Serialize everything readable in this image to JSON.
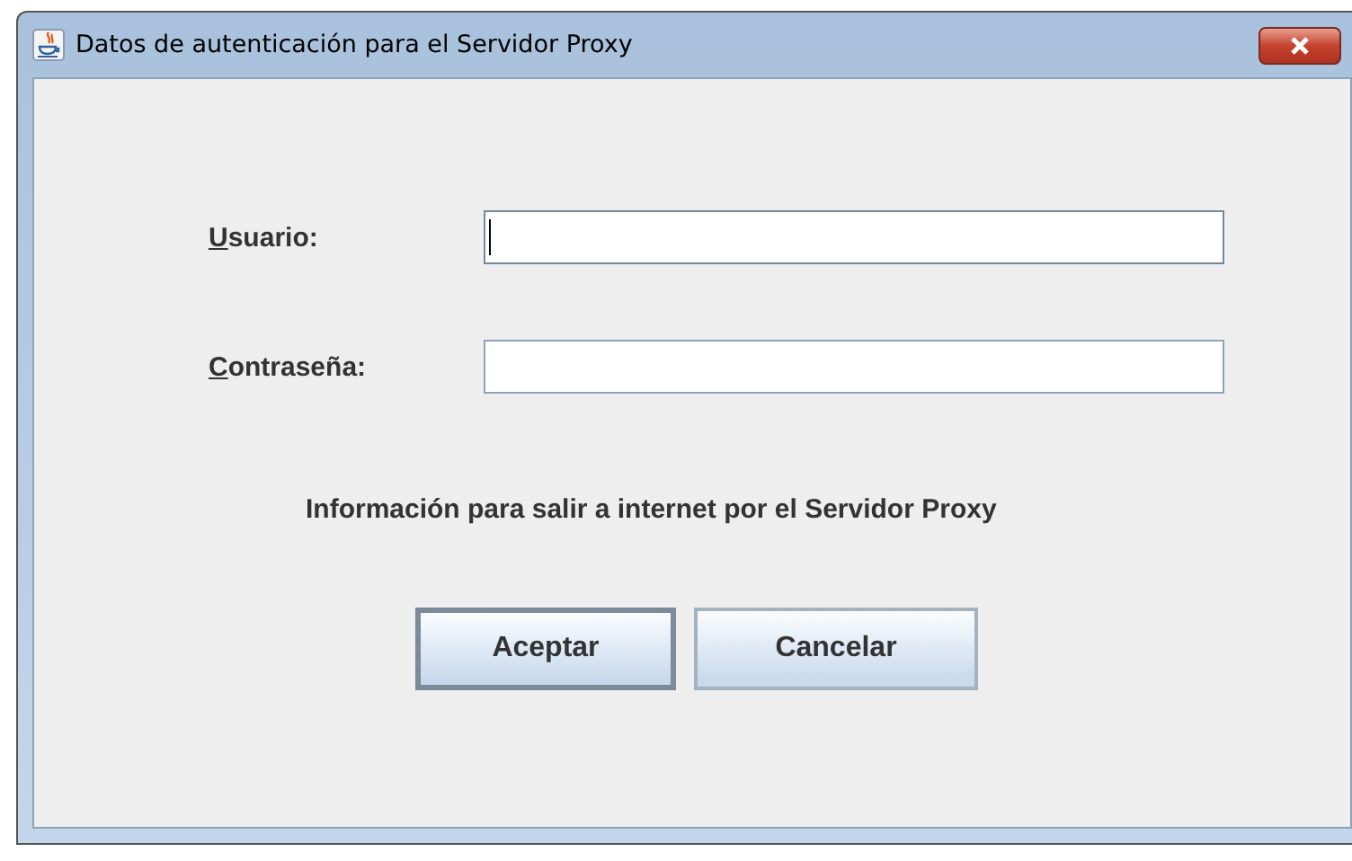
{
  "window": {
    "title": "Datos de autenticación para el Servidor Proxy"
  },
  "fields": [
    {
      "label": "Usuario:",
      "focused": true
    },
    {
      "label": "Contraseña:",
      "focused": false
    }
  ],
  "message": "Información para salir a internet por el Servidor Proxy",
  "buttons": [
    {
      "label": "Aceptar",
      "default": true
    },
    {
      "label": "Cancelar",
      "default": false
    }
  ]
}
